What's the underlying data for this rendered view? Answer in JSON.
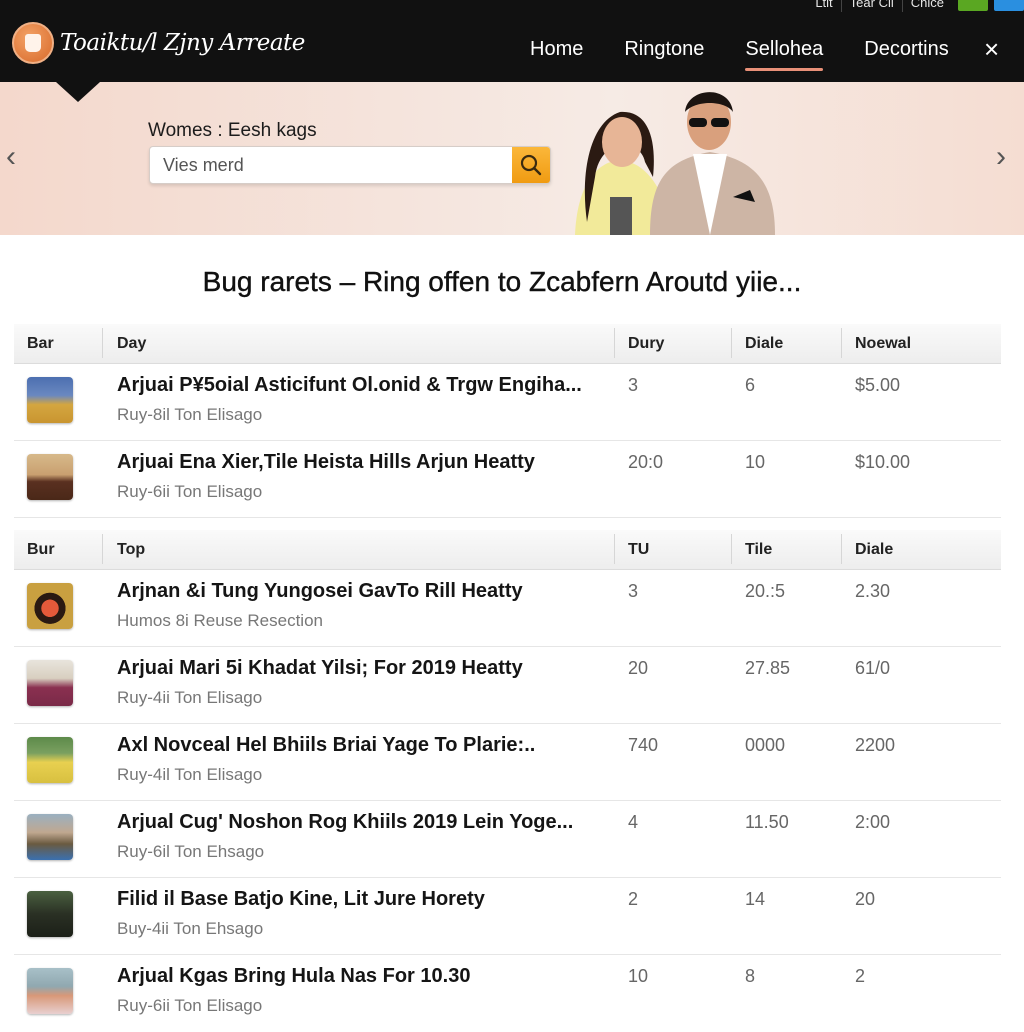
{
  "header": {
    "logo_text": "Toaiktu/l Zjny Arreate",
    "utility_links": [
      "Ltit",
      "Tear Cli",
      "Cnice"
    ],
    "utility_buttons": [
      {
        "name": "green-button",
        "color": "#5aa722"
      },
      {
        "name": "blue-button",
        "color": "#2a8fe0"
      }
    ],
    "nav": [
      {
        "label": "Home",
        "active": false
      },
      {
        "label": "Ringtone",
        "active": false
      },
      {
        "label": "Sellohea",
        "active": true
      },
      {
        "label": "Decortins",
        "active": false
      }
    ],
    "close_icon": "×",
    "accent_color": "#e89078"
  },
  "hero": {
    "label": "Womes : Eesh kags",
    "search_value": "Vies merd",
    "search_placeholder": "Vies merd",
    "prev_arrow": "‹",
    "next_arrow": "›"
  },
  "page_title": "Bug rarets – Ring offen to Zcabfern Aroutd yiie...",
  "table1": {
    "headers": [
      "Bar",
      "Day",
      "Dury",
      "Diale",
      "Noewal"
    ],
    "rows": [
      {
        "title": "Arjuai P¥5oial Asticifunt Ol.onid & Trgw Engiha...",
        "subtitle": "Ruy-8il Ton Elisago",
        "c1": "3",
        "c2": "6",
        "c3": "$5.00"
      },
      {
        "title": "Arjuai Ena Xier,Tile Heista Hills Arjun Heatty",
        "subtitle": "Ruy-6ii Ton Elisago",
        "c1": "20:0",
        "c2": "10",
        "c3": "$10.00"
      }
    ]
  },
  "table2": {
    "headers": [
      "Bur",
      "Top",
      "TU",
      "Tile",
      "Diale"
    ],
    "rows": [
      {
        "title": "Arjnan &i Tung Yungosei GavTo Rill Heatty",
        "subtitle": "Humos 8i Reuse Resection",
        "c1": "3",
        "c2": "20.:5",
        "c3": "2.30"
      },
      {
        "title": "Arjuai Mari 5i Khadat Yilsi; For 2019 Heatty",
        "subtitle": "Ruy-4ii Ton Elisago",
        "c1": "20",
        "c2": "27.85",
        "c3": "61/0"
      },
      {
        "title": "Axl Novceal Hel Bhiils Briai Yage To Plarie:..",
        "subtitle": "Ruy-4il Ton Elisago",
        "c1": "740",
        "c2": "0000",
        "c3": "2200"
      },
      {
        "title": "Arjual Cug' Noshon Rog Khiils 2019 Lein Yoge...",
        "subtitle": "Ruy-6il Ton Ehsago",
        "c1": "4",
        "c2": "11.50",
        "c3": "2:00"
      },
      {
        "title": "Filid il Base Batjo Kine, Lit Jure Horety",
        "subtitle": "Buy-4ii Ton Ehsago",
        "c1": "2",
        "c2": "14",
        "c3": "20"
      },
      {
        "title": "Arjual Kgas Bring Hula Nas For 10.30",
        "subtitle": "Ruy-6ii Ton Elisago",
        "c1": "10",
        "c2": "8",
        "c3": "2"
      }
    ]
  }
}
